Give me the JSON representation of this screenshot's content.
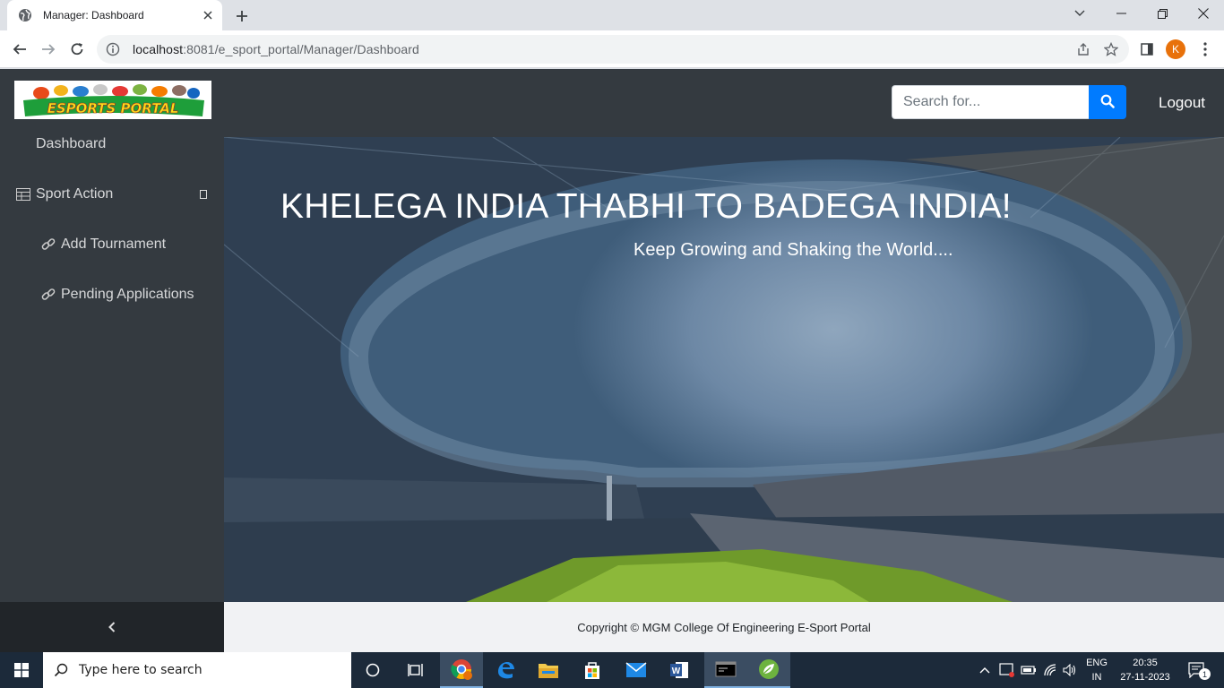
{
  "browser": {
    "tab_title": "Manager: Dashboard",
    "url_host": "localhost",
    "url_rest": ":8081/e_sport_portal/Manager/Dashboard",
    "profile_initial": "K"
  },
  "page": {
    "logo_text": "ESPORTS PORTAL",
    "search_placeholder": "Search for...",
    "logout_label": "Logout",
    "sidebar": {
      "dashboard": "Dashboard",
      "sport_action": "Sport Action",
      "add_tournament": "Add Tournament",
      "pending_applications": "Pending Applications"
    },
    "hero_title": "KHELEGA INDIA THABHI TO BADEGA INDIA!",
    "hero_subtitle": "Keep Growing and Shaking the World....",
    "footer_text": "Copyright © MGM College Of Engineering E-Sport Portal"
  },
  "taskbar": {
    "search_placeholder": "Type here to search",
    "lang_top": "ENG",
    "lang_bottom": "IN",
    "time": "20:35",
    "date": "27-11-2023",
    "notification_count": "1"
  },
  "colors": {
    "navbar": "#343a40",
    "accent": "#007bff",
    "taskbar": "#1c2a3a"
  }
}
